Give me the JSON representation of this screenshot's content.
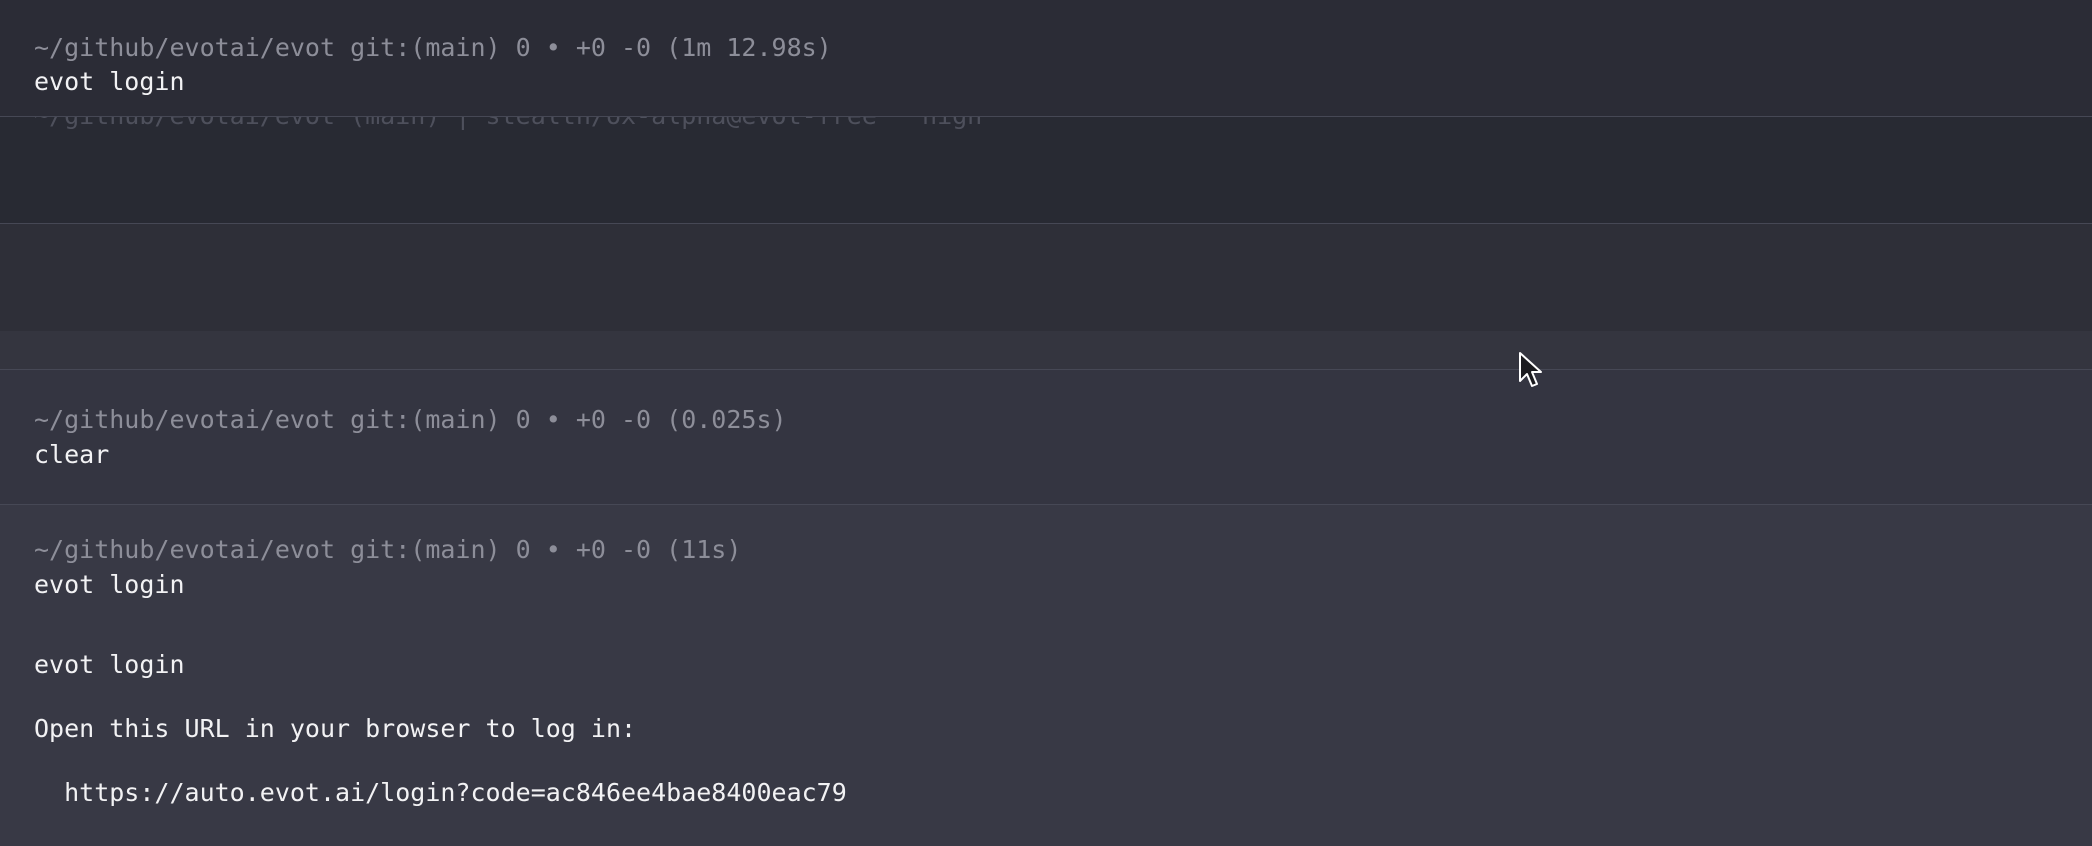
{
  "blocks": [
    {
      "prompt": "~/github/evotai/evot git:(main) 0 • +0 -0 (1m 12.98s)",
      "command": "evot login"
    },
    {
      "ghost_line": "~/github/evotai/evot (main) | stealth/ox-alpha@evot-free · high"
    },
    {
      "prompt": "~/github/evotai/evot git:(main) 0 • +0 -0 (0.025s)",
      "command": "clear"
    },
    {
      "prompt": "~/github/evotai/evot git:(main) 0 • +0 -0 (11s)",
      "command": "evot login",
      "output": [
        "evot login",
        "Open this URL in your browser to log in:",
        "  https://auto.evot.ai/login?code=ac846ee4bae8400eac79"
      ]
    }
  ],
  "colors": {
    "background_top": "#2b2c36",
    "prompt_text": "#8d8e99",
    "command_text": "#f2f2f4",
    "divider": "#464855"
  },
  "icons": {
    "cursor": "mouse-pointer-icon"
  }
}
